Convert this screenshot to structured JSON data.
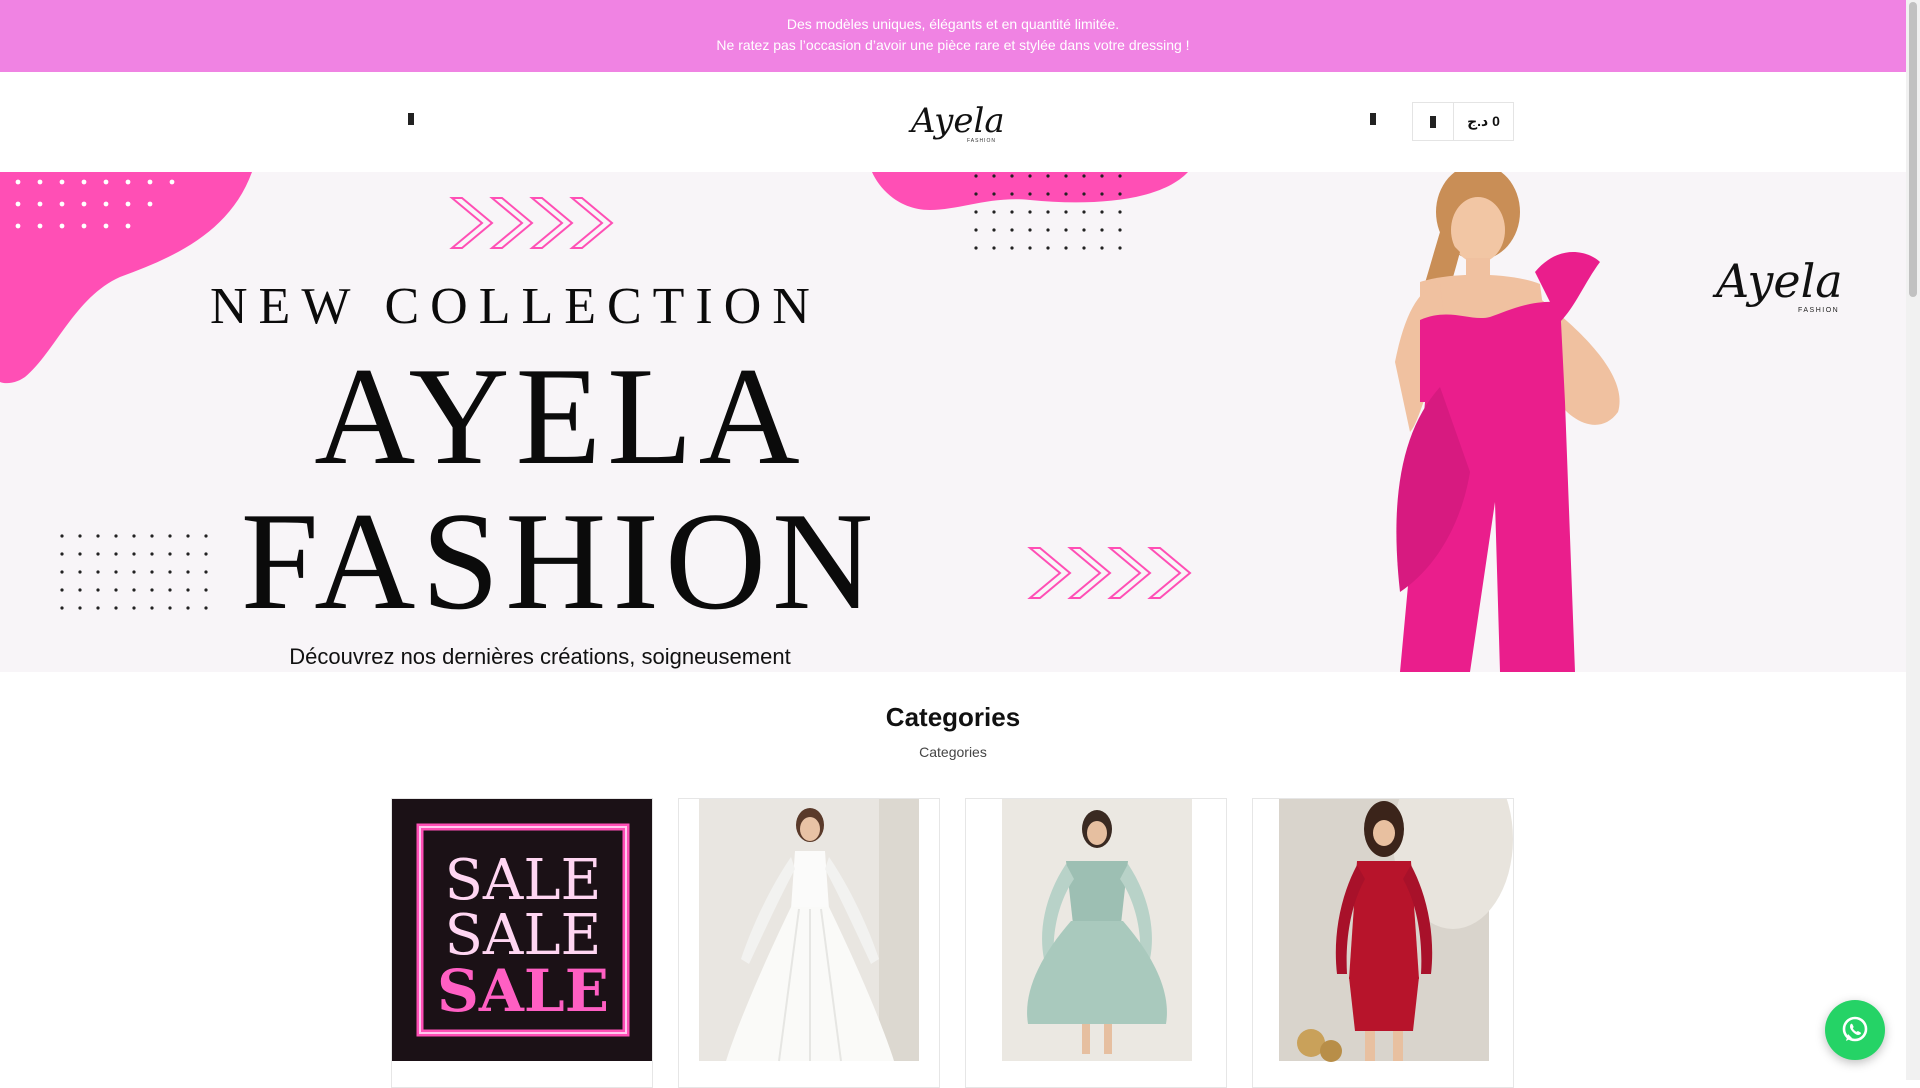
{
  "announcement": {
    "line1": "Des modèles uniques, élégants et en quantité limitée.",
    "line2": "Ne ratez pas l’occasion d’avoir une pièce rare et stylée dans votre dressing !"
  },
  "header": {
    "logo_text": "Ayela",
    "logo_subtext": "FASHION",
    "cart_total": "0 د.ج",
    "icons": [
      "menu-icon",
      "search-icon",
      "shopping-bag-icon"
    ]
  },
  "hero": {
    "headline_top": "NEW COLLECTION",
    "headline_1": "AYELA",
    "headline_2": "FASHION",
    "subtitle": "Découvrez nos dernières créations, soigneusement",
    "brand_script": "Ayela",
    "brand_small": "FASHION"
  },
  "categories": {
    "title": "Categories",
    "subtitle": "Categories",
    "cards": [
      {
        "sign_word": "SALE"
      },
      {},
      {},
      {}
    ]
  },
  "colors": {
    "announcement_bg": "#f083e3",
    "hero_pink": "#ff4fb5",
    "jumpsuit": "#ea1e8c",
    "whatsapp": "#25d366"
  }
}
